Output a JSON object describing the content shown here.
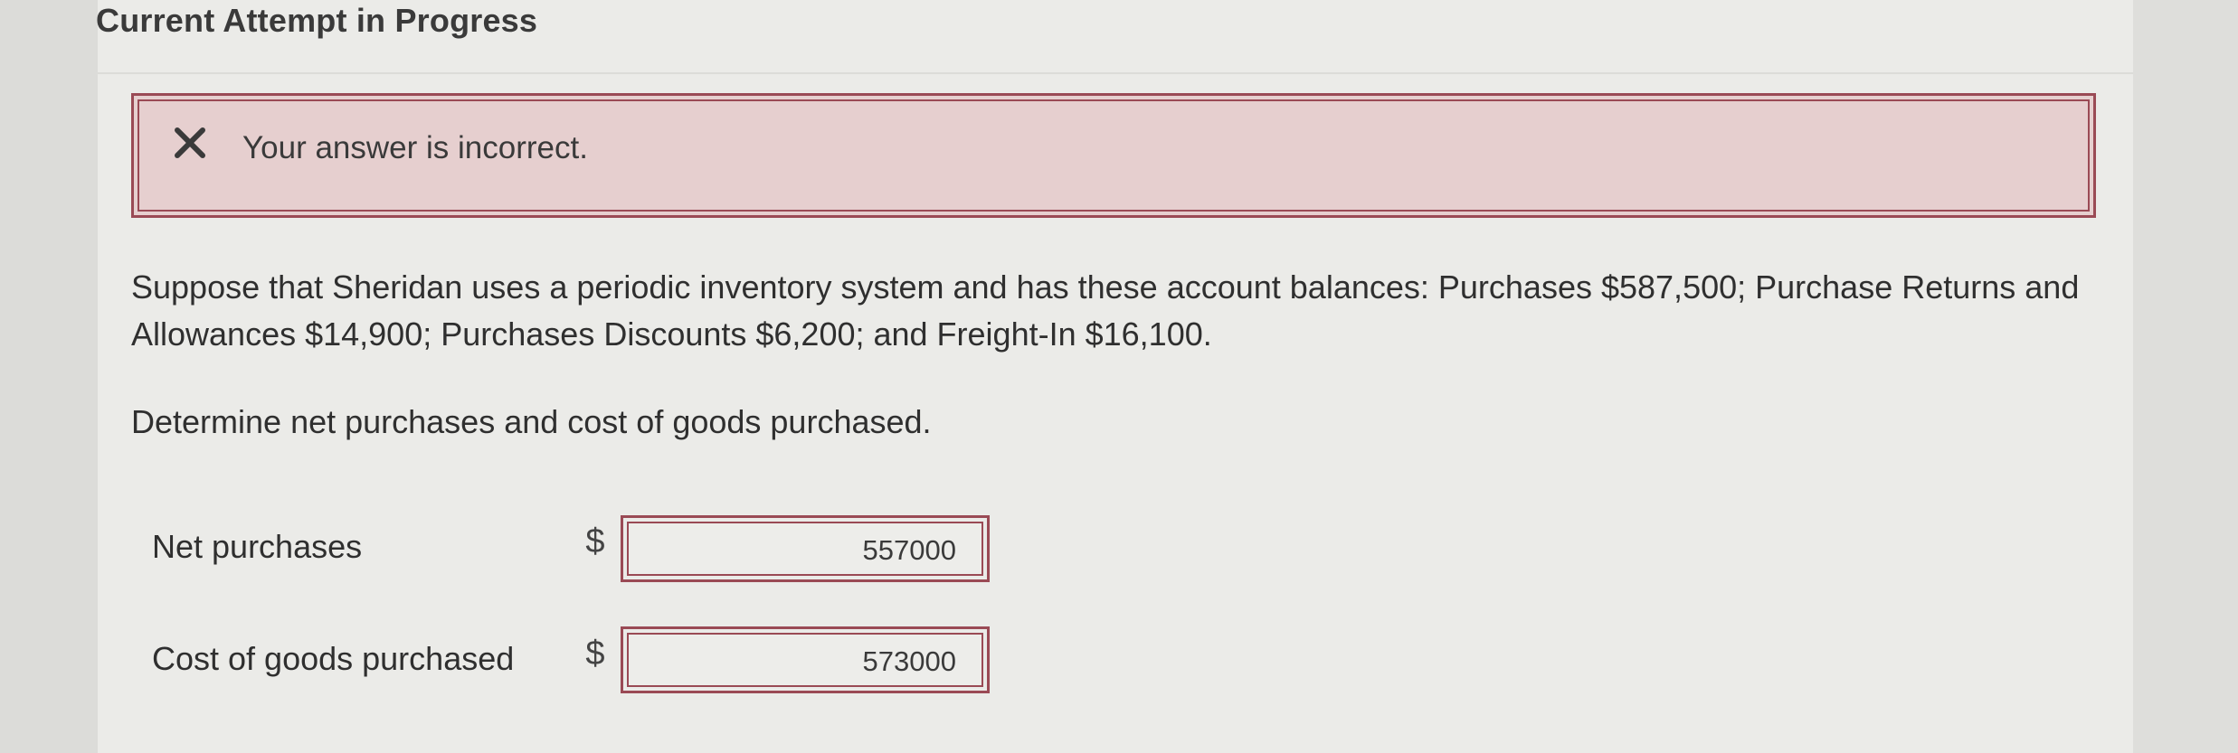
{
  "header": {
    "title": "Current Attempt in Progress"
  },
  "feedback": {
    "icon": "close-icon",
    "message": "Your answer is incorrect.",
    "border_color": "#9a4a55",
    "background_color": "#e6cfcf"
  },
  "question": {
    "text": "Suppose that Sheridan uses a periodic inventory system and has these account balances: Purchases $587,500; Purchase Returns and Allowances $14,900; Purchases Discounts $6,200; and Freight-In $16,100.",
    "prompt": "Determine net purchases and cost of goods purchased."
  },
  "answers": [
    {
      "label": "Net purchases",
      "currency": "$",
      "value": "557000"
    },
    {
      "label": "Cost of goods purchased",
      "currency": "$",
      "value": "573000"
    }
  ]
}
